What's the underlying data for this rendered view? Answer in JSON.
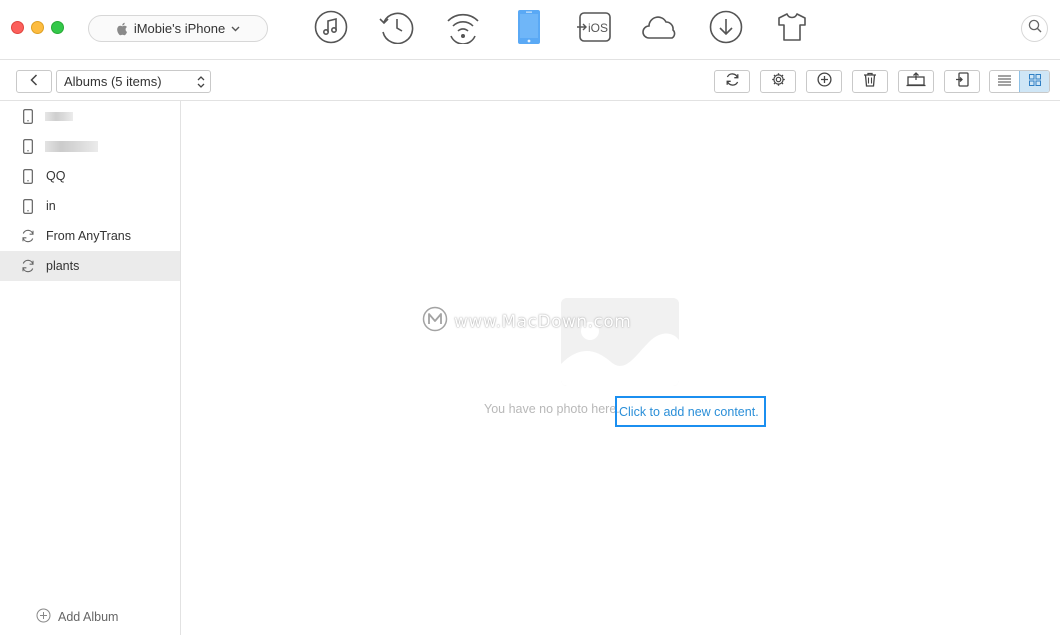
{
  "window": {
    "device_name": "iMobie's iPhone"
  },
  "topnav": {
    "items": [
      {
        "icon": "music-icon"
      },
      {
        "icon": "history-icon"
      },
      {
        "icon": "wifi-icon"
      },
      {
        "icon": "iphone-icon",
        "active": true
      },
      {
        "icon": "to-ios-icon",
        "label": "iOS"
      },
      {
        "icon": "cloud-icon"
      },
      {
        "icon": "download-icon"
      },
      {
        "icon": "tshirt-icon"
      }
    ],
    "active_color": "#5aa9f5"
  },
  "toolbar": {
    "album_select_value": "Albums (5 items)",
    "buttons": [
      "refresh-icon",
      "gear-icon",
      "add-icon",
      "trash-icon",
      "to-computer-icon",
      "to-device-icon"
    ],
    "view_modes": [
      "list-view-icon",
      "grid-view-icon"
    ],
    "active_view": "grid"
  },
  "sidebar": {
    "albums": [
      {
        "label": "",
        "icon": "phone-icon",
        "redacted": true
      },
      {
        "label": "",
        "icon": "phone-icon",
        "redacted": true
      },
      {
        "label": "QQ",
        "icon": "phone-icon"
      },
      {
        "label": "in",
        "icon": "phone-icon"
      },
      {
        "label": "From AnyTrans",
        "icon": "sync-icon"
      },
      {
        "label": "plants",
        "icon": "sync-icon",
        "selected": true
      }
    ],
    "add_album_label": "Add Album"
  },
  "content": {
    "empty_message": "You have no photo here.",
    "add_link": "Click to add new content.",
    "watermark": "www.MacDown.com"
  }
}
